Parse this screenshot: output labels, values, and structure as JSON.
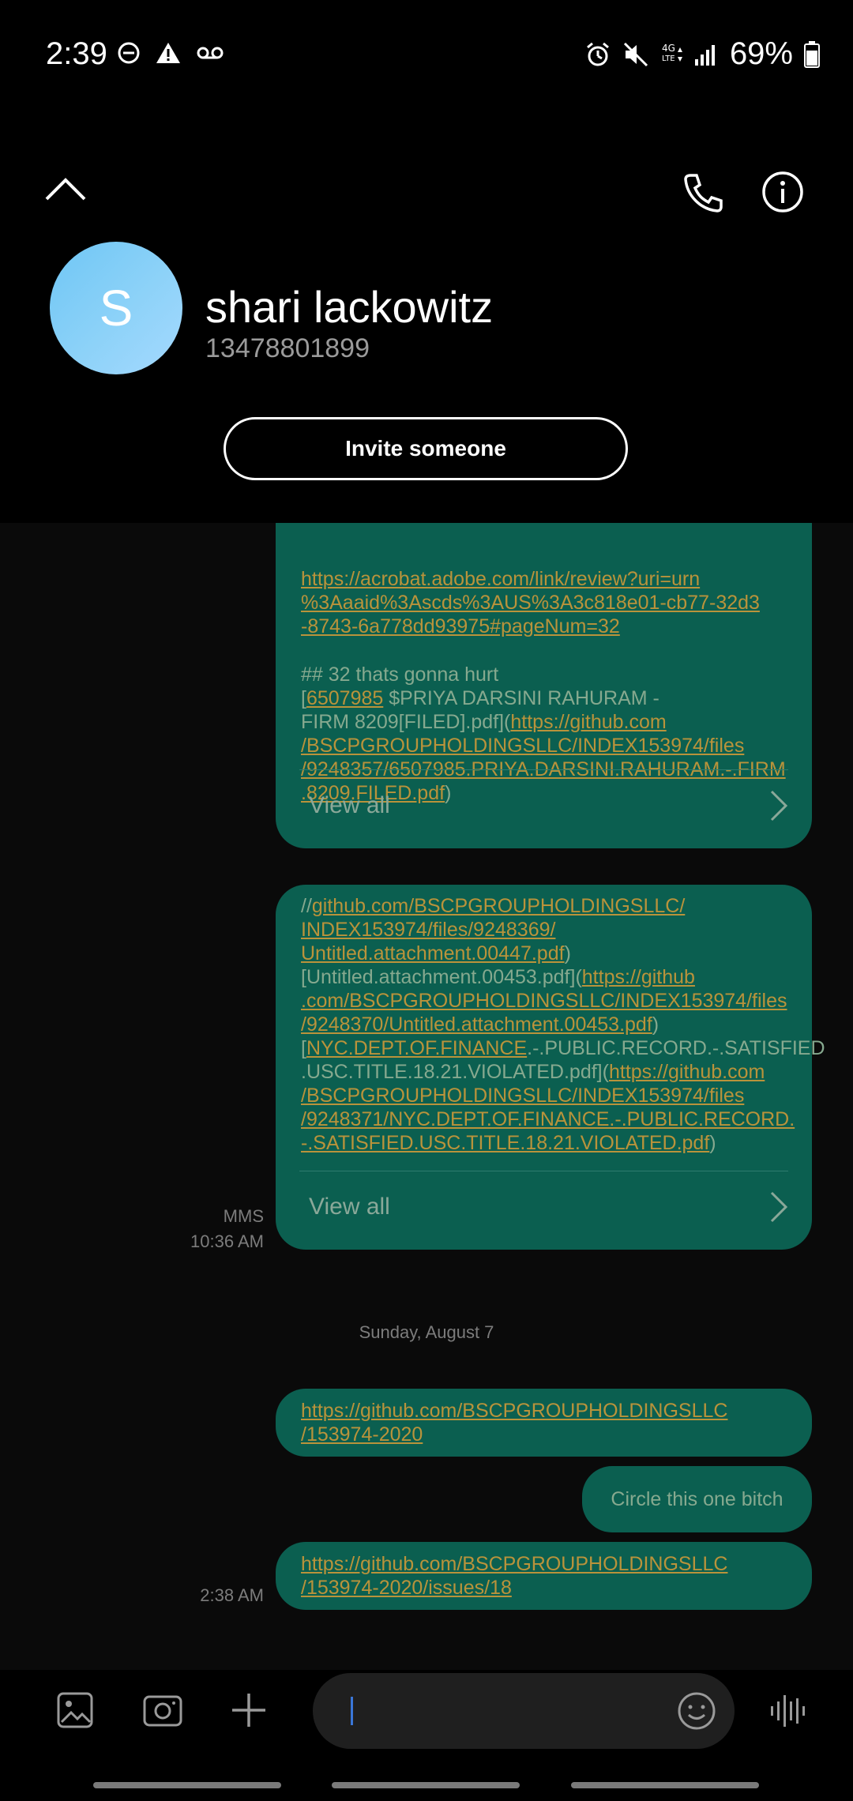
{
  "status_bar": {
    "time": "2:39",
    "battery": "69%",
    "icons": [
      "dnd-icon",
      "alert-icon",
      "voicemail-icon",
      "alarm-icon",
      "mute-icon",
      "4g-lte-icon",
      "signal-icon",
      "battery-icon"
    ]
  },
  "header": {
    "avatar_initial": "S",
    "contact_name": "shari lackowitz",
    "contact_number": "13478801899",
    "invite_label": "Invite someone",
    "icons": [
      "collapse-chevron-icon",
      "phone-icon",
      "info-icon"
    ]
  },
  "messages": {
    "bubble1": {
      "link1": "https://acrobat.adobe.com/link/review?uri=urn%3Aaaid%3Ascds%3AUS%3A3c818e01-cb77-32d3-8743-6a778dd93975#pageNum=32",
      "link1_lines": [
        "https://acrobat.adobe.com/link/review?uri=urn",
        "%3Aaaid%3Ascds%3AUS%3A3c818e01-cb77-32d3",
        "-8743-6a778dd93975#pageNum=32"
      ],
      "heading": "## 32 thats gonna hurt",
      "bracket": "[",
      "id_link": "6507985",
      "text_a": " $PRIYA DARSINI RAHURAM -",
      "text_b": "FIRM 8209[FILED].pdf](",
      "gh_lines": [
        "https://github.com",
        "/BSCPGROUPHOLDINGSLLC/INDEX153974/files",
        "/9248357/6507985.PRIYA.DARSINI.RAHURAM.-.FIRM",
        ".8209.FILED.pdf"
      ],
      "close": ")",
      "view_all": "View all"
    },
    "bubble2": {
      "prefix": "//",
      "l1": "github.com/BSCPGROUPHOLDINGSLLC/",
      "l2": "INDEX153974/files/9248369/",
      "l3": "Untitled.attachment.00447.pdf",
      "close": ")",
      "t4": "[Untitled.attachment.00453.pdf](",
      "l4": "https://github",
      "l5": ".com/BSCPGROUPHOLDINGSLLC/INDEX153974/files",
      "l6": "/9248370/Untitled.attachment.00453.pdf",
      "t7a": "[",
      "l7": "NYC.DEPT.OF.FINANCE",
      "t7b": ".-.PUBLIC.RECORD.-.SATISFIED",
      "t8": ".USC.TITLE.18.21.VIOLATED.pdf](",
      "l8": "https://github.com",
      "l9": "/BSCPGROUPHOLDINGSLLC/INDEX153974/files",
      "l10": "/9248371/NYC.DEPT.OF.FINANCE.-.PUBLIC.RECORD.",
      "l11": "-.SATISFIED.USC.TITLE.18.21.VIOLATED.pdf",
      "view_all": "View all",
      "meta_type": "MMS",
      "meta_time": "10:36 AM"
    },
    "date_separator": "Sunday, August 7",
    "bubble3": {
      "l1": "https://github.com/BSCPGROUPHOLDINGSLLC",
      "l2": "/153974-2020"
    },
    "bubble4": {
      "text": "Circle this one bitch"
    },
    "bubble5": {
      "l1": "https://github.com/BSCPGROUPHOLDINGSLLC",
      "l2": "/153974-2020/issues/18",
      "meta_time": "2:38 AM"
    }
  },
  "composer": {
    "placeholder": "",
    "icons": [
      "gallery-icon",
      "camera-icon",
      "add-icon",
      "emoji-icon",
      "voice-icon"
    ]
  }
}
